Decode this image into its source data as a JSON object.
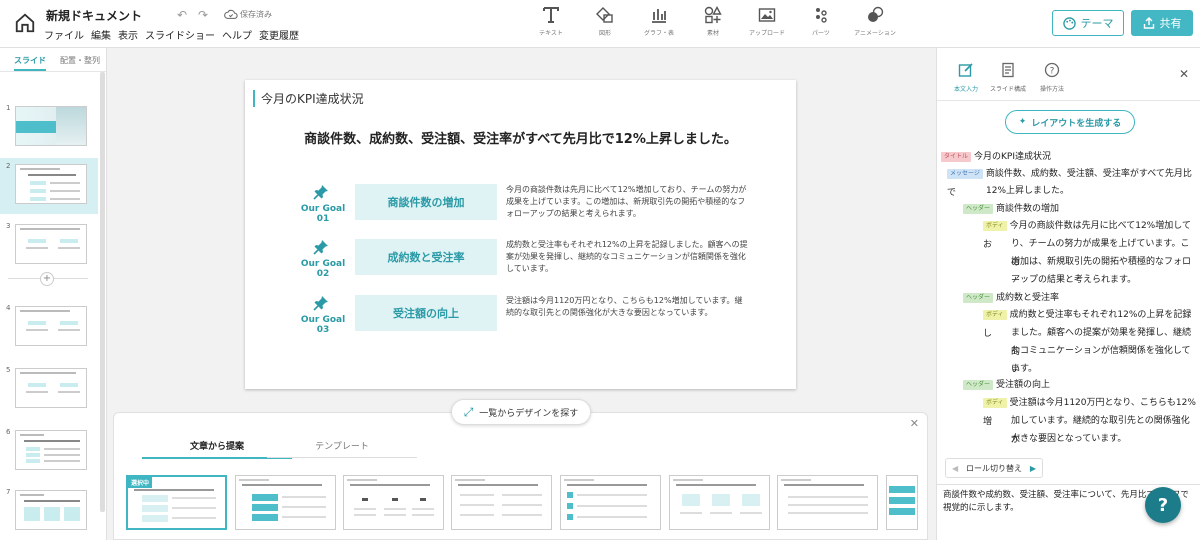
{
  "header": {
    "doc_title": "新規ドキュメント",
    "menu": [
      "ファイル",
      "編集",
      "表示",
      "スライドショー",
      "ヘルプ",
      "変更履歴"
    ],
    "saved": "保存済み",
    "tools": [
      "テキスト",
      "図形",
      "グラフ・表",
      "素材",
      "アップロード",
      "パーツ",
      "アニメーション"
    ],
    "theme": "テーマ",
    "share": "共有"
  },
  "left": {
    "tabs": [
      "スライド",
      "配置・整列"
    ],
    "slides": [
      "1",
      "2",
      "3",
      "4",
      "5",
      "6",
      "7"
    ]
  },
  "slide": {
    "title": "今月のKPI達成状況",
    "message": "商談件数、成約数、受注額、受注率がすべて先月比で12%上昇しました。",
    "goals": [
      {
        "label": "Our Goal 01",
        "heading": "商談件数の増加",
        "body": "今月の商談件数は先月に比べて12%増加しており、チームの努力が成果を上げています。この増加は、新規取引先の開拓や積極的なフォローアップの結果と考えられます。"
      },
      {
        "label": "Our Goal 02",
        "heading": "成約数と受注率",
        "body": "成約数と受注率もそれぞれ12%の上昇を記録しました。顧客への提案が効果を発揮し、継続的なコミュニケーションが信頼関係を強化しています。"
      },
      {
        "label": "Our Goal 03",
        "heading": "受注額の向上",
        "body": "受注額は今月1120万円となり、こちらも12%増加しています。継続的な取引先との関係強化が大きな要因となっています。"
      }
    ]
  },
  "design_button": "一覧からデザインを探す",
  "bottom_panel": {
    "tabs": [
      "文章から提案",
      "テンプレート"
    ],
    "selected_badge": "選択中"
  },
  "right": {
    "tools": [
      "本文入力",
      "スライド構成",
      "操作方法"
    ],
    "generate": "レイアウトを生成する",
    "tags": {
      "title": "タイトル",
      "message": "メッセージ",
      "header": "ヘッダー",
      "body": "ボディ"
    },
    "tree": {
      "title": "今月のKPI達成状況",
      "message_l1": "商談件数、成約数、受注額、受注率がすべて先月比で",
      "message_l2": "12%上昇しました。",
      "h1": "商談件数の増加",
      "b1": [
        "今月の商談件数は先月に比べて12%増加してお",
        "り、チームの努力が成果を上げています。この",
        "増加は、新規取引先の開拓や積極的なフォロー",
        "アップの結果と考えられます。"
      ],
      "h2": "成約数と受注率",
      "b2": [
        "成約数と受注率もそれぞれ12%の上昇を記録し",
        "ました。顧客への提案が効果を発揮し、継続的",
        "なコミュニケーションが信頼関係を強化してい",
        "ます。"
      ],
      "h3": "受注額の向上",
      "b3": [
        "受注額は今月1120万円となり、こちらも12%増",
        "加しています。継続的な取引先との関係強化が",
        "大きな要因となっています。"
      ]
    },
    "role_switch": "ロール切り替え",
    "summary": "商談件数や成約数、受注額、受注率について、先月比でグラフで視覚的に示します。"
  },
  "colors": {
    "accent": "#43b8c4",
    "accent_dark": "#2a9aa6",
    "help": "#1c7c8a"
  }
}
